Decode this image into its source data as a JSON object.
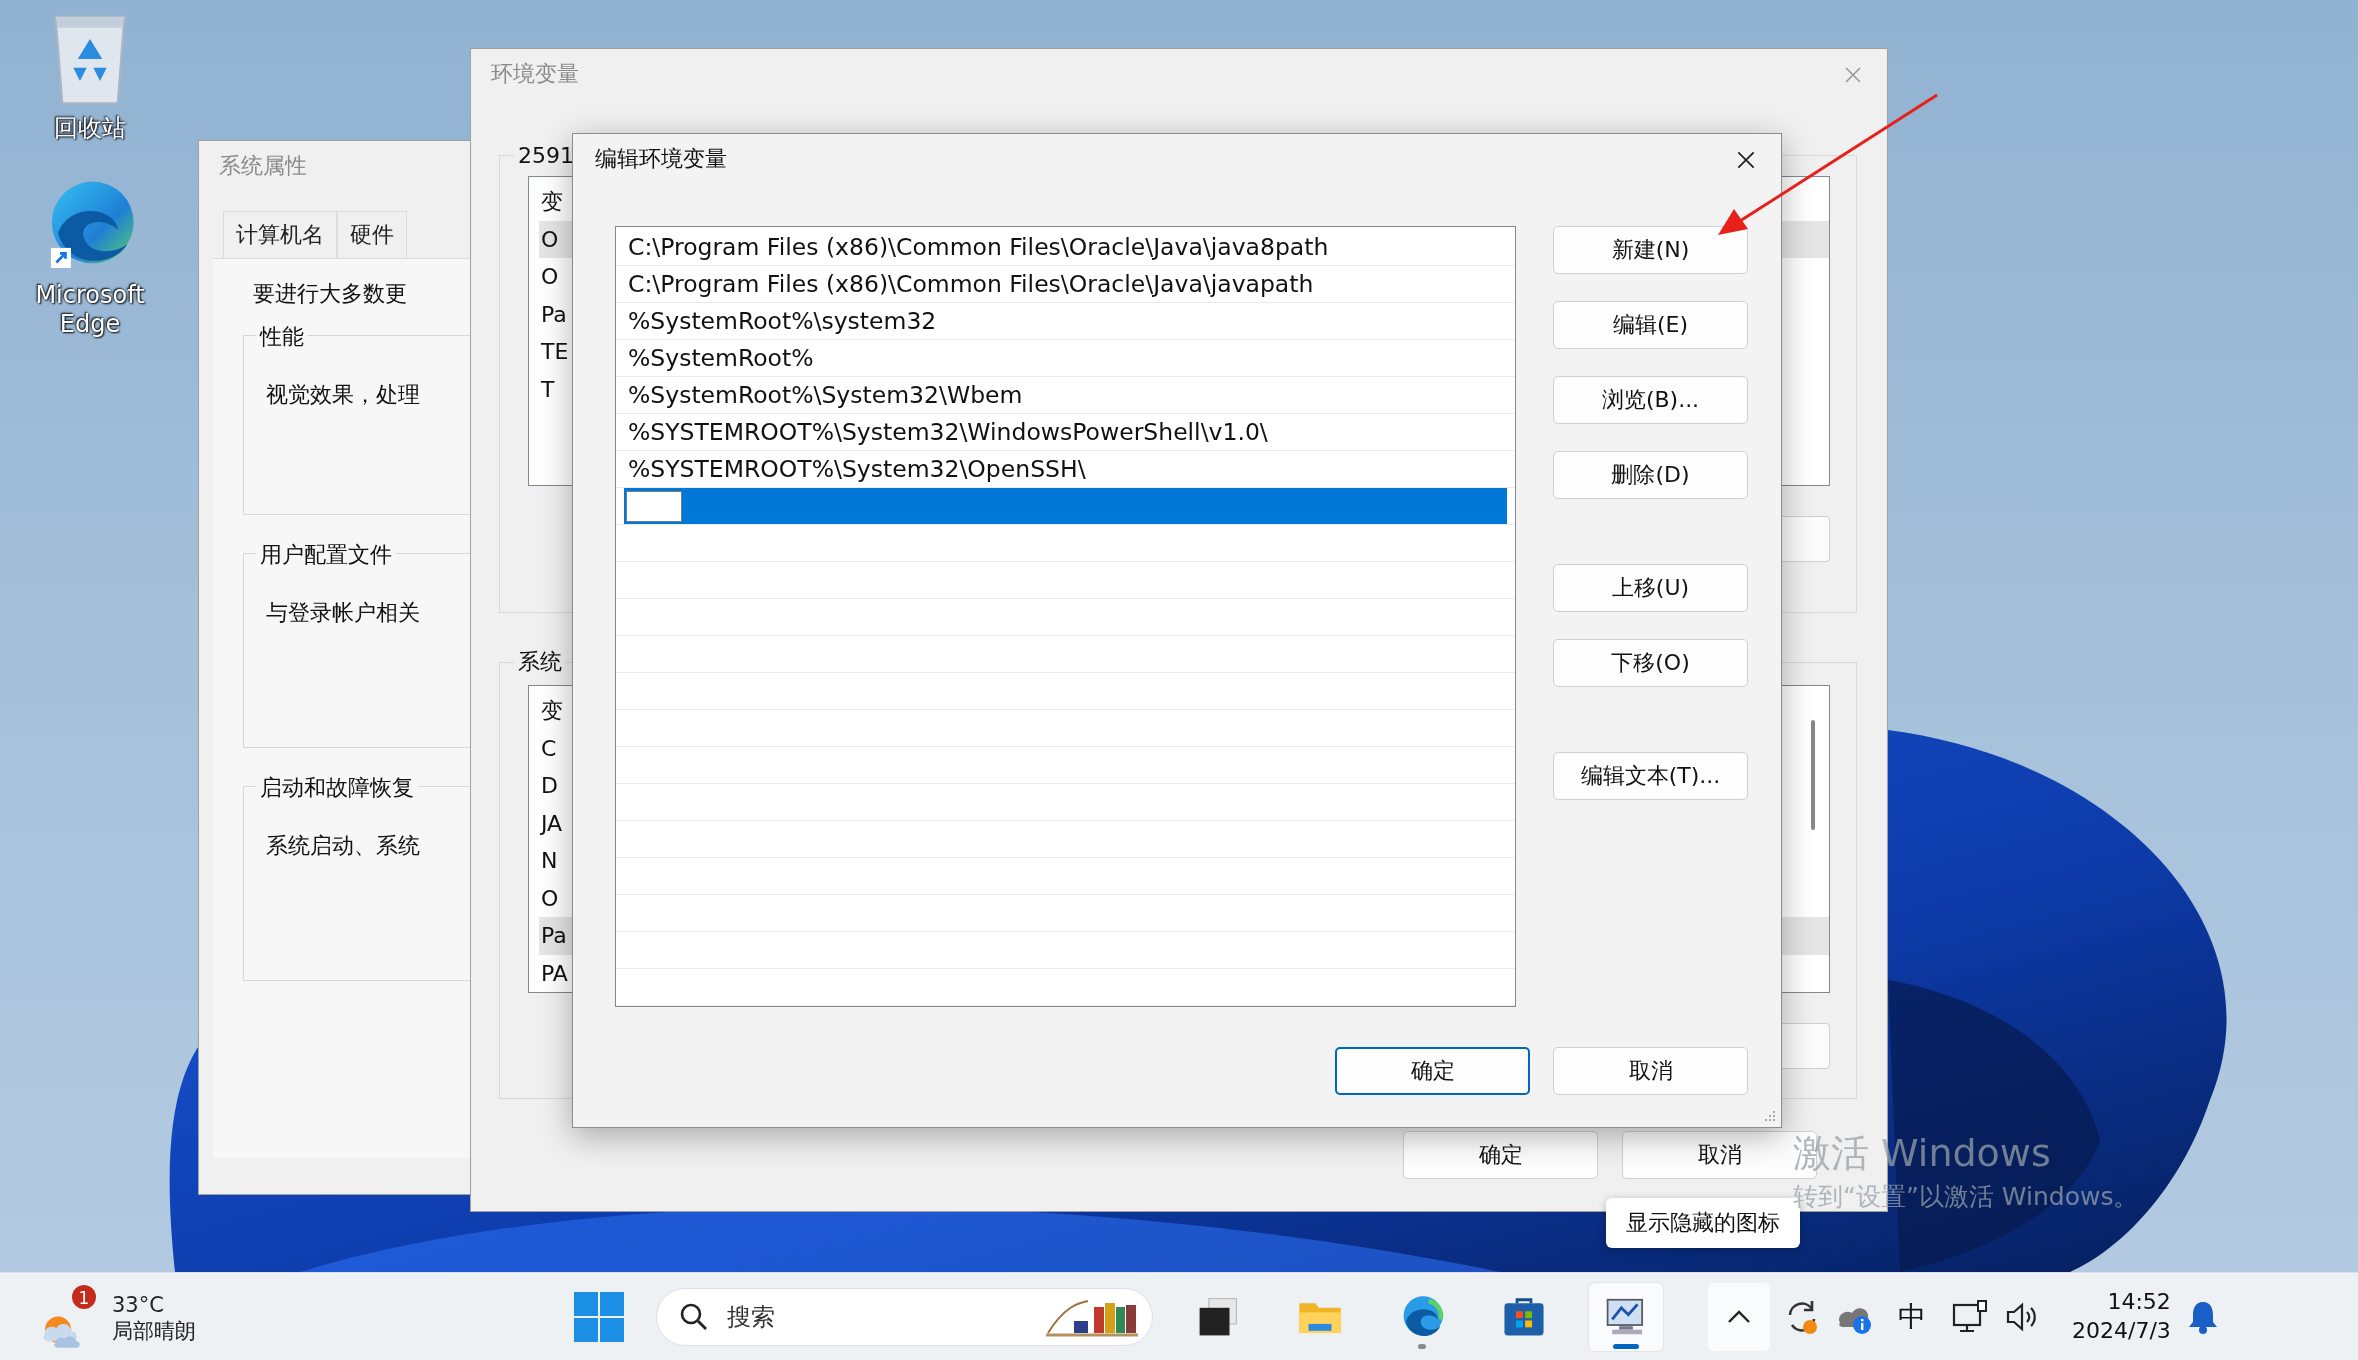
{
  "desktop_icons": [
    {
      "kind": "recycle-bin",
      "label": "回收站"
    },
    {
      "kind": "edge",
      "label": "Microsoft Edge"
    }
  ],
  "system_properties": {
    "title": "系统属性",
    "tabs": [
      {
        "label": "计算机名",
        "selected": false
      },
      {
        "label": "硬件",
        "selected": false
      }
    ],
    "intro": "要进行大多数更",
    "groups": [
      {
        "title": "性能",
        "text": "视觉效果，处理"
      },
      {
        "title": "用户配置文件",
        "text": "与登录帐户相关"
      },
      {
        "title": "启动和故障恢复",
        "text": "系统启动、系统"
      }
    ]
  },
  "environment_variables": {
    "title": "环境变量",
    "user_group": {
      "label": "2591",
      "header": "变",
      "rows": [
        {
          "text": "O",
          "selected": true
        },
        {
          "text": "O",
          "selected": false
        },
        {
          "text": "Pa",
          "selected": false
        },
        {
          "text": "TE",
          "selected": false
        },
        {
          "text": "T",
          "selected": false
        }
      ]
    },
    "system_group": {
      "label": "系统",
      "header": "变",
      "rows": [
        {
          "text": "C",
          "selected": false
        },
        {
          "text": "D",
          "selected": false
        },
        {
          "text": "JA",
          "selected": false
        },
        {
          "text": "N",
          "selected": false
        },
        {
          "text": "O",
          "selected": false
        },
        {
          "text": "Pa",
          "selected": true
        },
        {
          "text": "PA",
          "selected": false
        }
      ]
    },
    "buttons": [
      {
        "label": "确定"
      },
      {
        "label": "取消"
      }
    ]
  },
  "edit_dialog": {
    "title": "编辑环境变量",
    "entries": [
      {
        "kind": "text",
        "text": "C:\\Program Files (x86)\\Common Files\\Oracle\\Java\\java8path",
        "selected": false
      },
      {
        "kind": "text",
        "text": "C:\\Program Files (x86)\\Common Files\\Oracle\\Java\\javapath",
        "selected": false
      },
      {
        "kind": "text",
        "text": "%SystemRoot%\\system32",
        "selected": false
      },
      {
        "kind": "text",
        "text": "%SystemRoot%",
        "selected": false
      },
      {
        "kind": "text",
        "text": "%SystemRoot%\\System32\\Wbem",
        "selected": false
      },
      {
        "kind": "text",
        "text": "%SYSTEMROOT%\\System32\\WindowsPowerShell\\v1.0\\",
        "selected": false
      },
      {
        "kind": "text",
        "text": "%SYSTEMROOT%\\System32\\OpenSSH\\",
        "selected": false
      },
      {
        "kind": "edit",
        "selected": true
      }
    ],
    "side_button_groups": [
      [
        "新建(N)",
        "编辑(E)",
        "浏览(B)...",
        "删除(D)"
      ],
      [
        "上移(U)",
        "下移(O)"
      ],
      [
        "编辑文本(T)..."
      ]
    ],
    "footer_buttons": [
      {
        "label": "确定",
        "default": true
      },
      {
        "label": "取消",
        "default": false
      }
    ]
  },
  "tooltip": "显示隐藏的图标",
  "activation_notice": {
    "title": "激活 Windows",
    "text": "转到“设置”以激活 Windows。"
  },
  "taskbar": {
    "weather": {
      "badge": "1",
      "temperature": "33°C",
      "condition": "局部晴朗"
    },
    "search": {
      "placeholder": "搜索"
    },
    "apps": [
      {
        "kind": "task-view",
        "selected": false,
        "running": false
      },
      {
        "kind": "explorer",
        "selected": false,
        "running": false
      },
      {
        "kind": "edge",
        "selected": false,
        "running": true
      },
      {
        "kind": "store",
        "selected": false,
        "running": false
      },
      {
        "kind": "control-panel",
        "selected": true,
        "running": true
      }
    ],
    "input_method": "中",
    "time": "14:52",
    "date": "2024/7/3"
  }
}
